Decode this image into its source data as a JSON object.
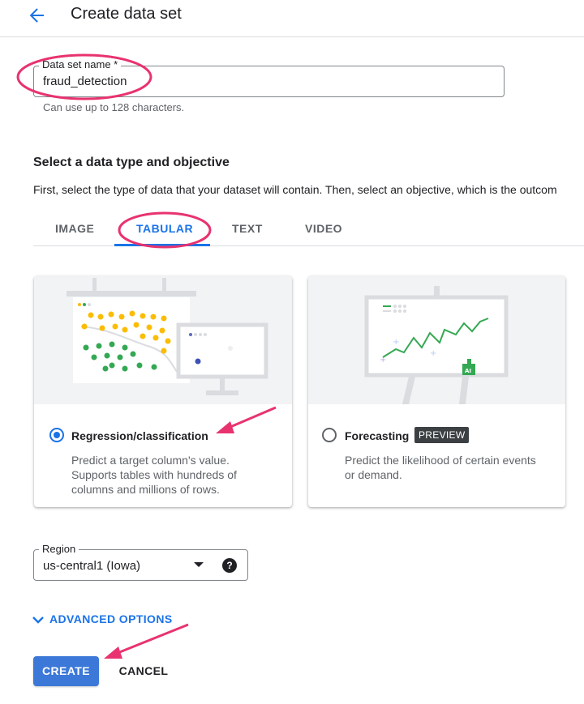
{
  "header": {
    "title": "Create data set"
  },
  "name_field": {
    "label": "Data set name *",
    "value": "fraud_detection",
    "hint": "Can use up to 128 characters."
  },
  "section": {
    "title": "Select a data type and objective",
    "description": "First, select the type of data that your dataset will contain. Then, select an objective, which is the outcom"
  },
  "tabs": [
    {
      "label": "IMAGE",
      "active": false
    },
    {
      "label": "TABULAR",
      "active": true
    },
    {
      "label": "TEXT",
      "active": false
    },
    {
      "label": "VIDEO",
      "active": false
    }
  ],
  "cards": [
    {
      "title": "Regression/classification",
      "desc_lines": [
        "Predict a target column's value.",
        "Supports tables with hundreds of",
        "columns and millions of rows."
      ],
      "selected": true
    },
    {
      "title": "Forecasting",
      "badge": "PREVIEW",
      "desc_lines": [
        "Predict the likelihood of certain events",
        "or demand."
      ],
      "selected": false
    }
  ],
  "illustration": {
    "ai_badge": "AI"
  },
  "region": {
    "label": "Region",
    "value": "us-central1 (Iowa)",
    "help_glyph": "?"
  },
  "advanced_options": {
    "label": "ADVANCED OPTIONS"
  },
  "buttons": {
    "create": "CREATE",
    "cancel": "CANCEL"
  },
  "colors": {
    "accent": "#1a73e8",
    "create_button": "#3c78d8",
    "annotation": "#e8336f",
    "dot_yellow": "#fbbc04",
    "dot_green": "#34a853"
  }
}
